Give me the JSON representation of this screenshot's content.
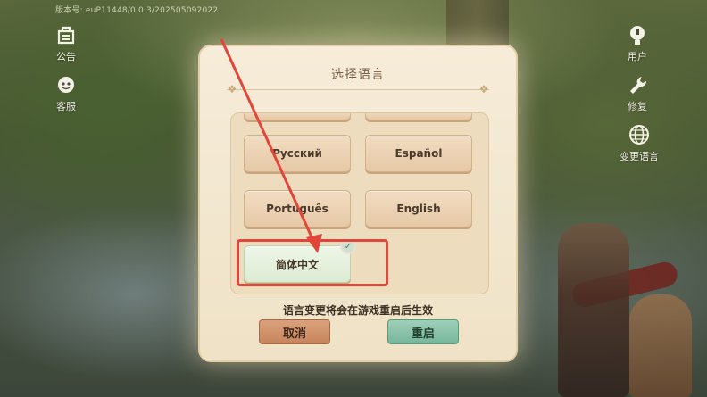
{
  "version_text": "版本号: euP11448/0.0.3/202505092022",
  "left_sidebar": [
    {
      "label": "公告",
      "icon": "announcement-icon"
    },
    {
      "label": "客服",
      "icon": "customer-service-icon"
    }
  ],
  "right_sidebar": [
    {
      "label": "用户",
      "icon": "user-icon"
    },
    {
      "label": "修复",
      "icon": "wrench-icon"
    },
    {
      "label": "变更语言",
      "icon": "globe-icon"
    }
  ],
  "dialog": {
    "title": "选择语言",
    "languages": [
      "Русский",
      "Español",
      "Português",
      "English",
      "简体中文"
    ],
    "selected_language": "简体中文",
    "notice": "语言变更将会在游戏重启后生效",
    "cancel_label": "取消",
    "restart_label": "重启"
  },
  "colors": {
    "annotation": "#e2463a",
    "cancel": "#c7845c",
    "restart": "#76b69a"
  }
}
